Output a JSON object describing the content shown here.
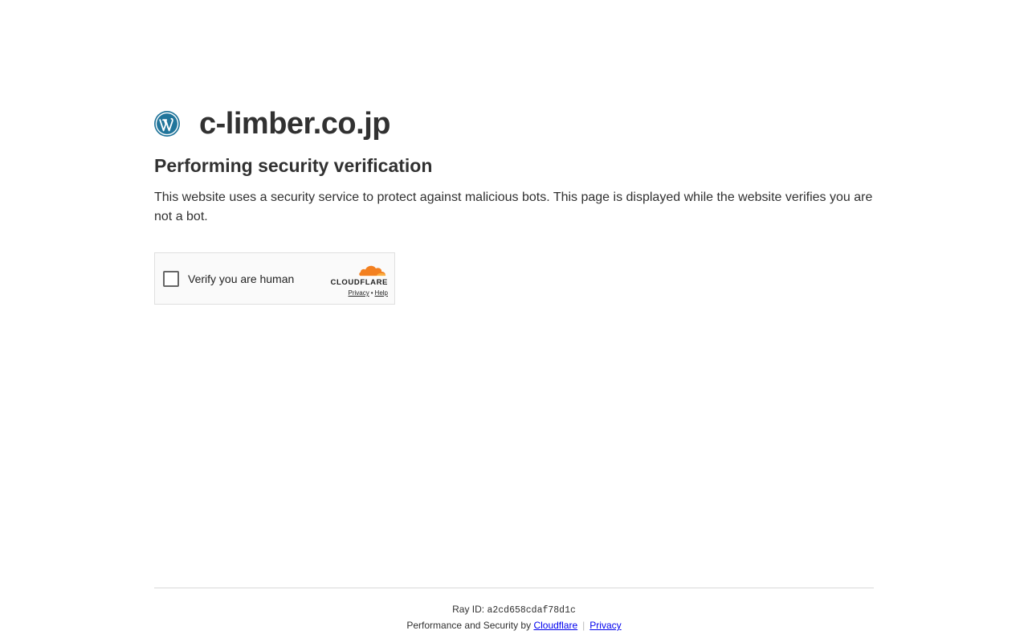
{
  "header": {
    "site_name": "c-limber.co.jp",
    "logo_icon": "wordpress-icon"
  },
  "main": {
    "heading": "Performing security verification",
    "description": "This website uses a security service to protect against malicious bots. This page is displayed while the website verifies you are not a bot."
  },
  "widget": {
    "checkbox_label": "Verify you are human",
    "brand": "CLOUDFLARE",
    "brand_icon": "cloudflare-cloud-icon",
    "privacy_link": "Privacy",
    "separator": "•",
    "help_link": "Help"
  },
  "footer": {
    "ray_label": "Ray ID:",
    "ray_id": "a2cd658cdaf78d1c",
    "performance_text": "Performance and Security by",
    "cloudflare_link": "Cloudflare",
    "divider": "|",
    "privacy_link": "Privacy"
  },
  "colors": {
    "text": "#313131",
    "wordpress_blue": "#21759b",
    "cloudflare_orange": "#f38020",
    "link_blue": "#0000ee"
  }
}
